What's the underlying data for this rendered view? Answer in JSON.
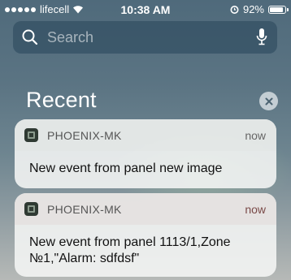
{
  "status_bar": {
    "carrier": "lifecell",
    "time": "10:38 AM",
    "battery": "92%",
    "battery_level": 0.92,
    "icons": [
      "signal-dots",
      "wifi-icon",
      "alarm-icon",
      "battery-icon"
    ]
  },
  "search": {
    "placeholder": "Search",
    "icons": [
      "search-icon",
      "microphone-icon"
    ]
  },
  "recent": {
    "title": "Recent",
    "clear_icon": "close-icon"
  },
  "notifications": [
    {
      "app": "PHOENIX-MK",
      "time": "now",
      "message": "New event from panel new image",
      "icon": "app-icon"
    },
    {
      "app": "PHOENIX-MK",
      "time": "now",
      "message": "New event from panel 1113/1,Zone №1,\"Alarm: sdfdsf\"",
      "icon": "app-icon"
    }
  ]
}
